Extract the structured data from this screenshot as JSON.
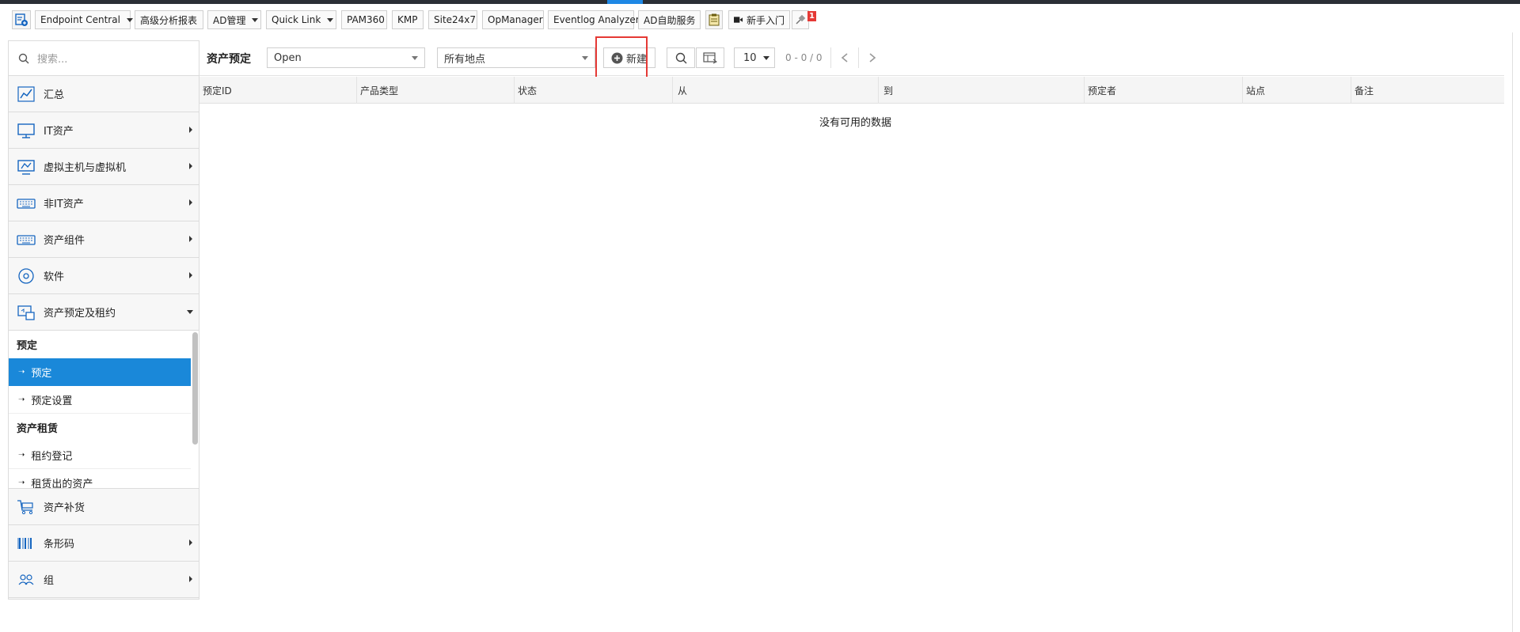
{
  "toolbar": {
    "endpoint_central": "Endpoint Central",
    "advanced_reports": "高级分析报表",
    "ad_manage": "AD管理",
    "quick_link": "Quick Link",
    "pam360": "PAM360",
    "kmp": "KMP",
    "site24x7": "Site24x7",
    "opmanager": "OpManager",
    "eventlog": "Eventlog Analyzer",
    "ad_selfservice": "AD自助服务",
    "getting_started": "新手入门",
    "notification_count": "1"
  },
  "sidebar": {
    "search_placeholder": "搜索...",
    "items": [
      {
        "label": "汇总",
        "icon": "chart-line-icon"
      },
      {
        "label": "IT资产",
        "icon": "monitor-icon"
      },
      {
        "label": "虚拟主机与虚拟机",
        "icon": "virtual-machine-icon"
      },
      {
        "label": "非IT资产",
        "icon": "keyboard-icon"
      },
      {
        "label": "资产组件",
        "icon": "component-icon"
      },
      {
        "label": "软件",
        "icon": "disc-icon"
      },
      {
        "label": "资产预定及租约",
        "icon": "reservation-icon"
      },
      {
        "label": "资产补货",
        "icon": "cart-icon"
      },
      {
        "label": "条形码",
        "icon": "barcode-icon"
      },
      {
        "label": "组",
        "icon": "group-icon"
      }
    ],
    "submenu": {
      "reservation_header": "预定",
      "reservation_item": "预定",
      "reservation_settings": "预定设置",
      "lease_header": "资产租赁",
      "lease_register": "租约登记",
      "leased_out": "租赁出的资产"
    }
  },
  "main": {
    "title": "资产预定",
    "status_select": "Open",
    "site_select": "所有地点",
    "new_button": "新建",
    "page_size": "10",
    "pager_text": "0 - 0 / 0",
    "columns": [
      "预定ID",
      "产品类型",
      "状态",
      "从",
      "到",
      "预定者",
      "站点",
      "备注"
    ],
    "empty_message": "没有可用的数据"
  },
  "colors": {
    "active_blue": "#1a88d9",
    "highlight_red": "#e53935",
    "top_bar": "#2b2f36"
  }
}
